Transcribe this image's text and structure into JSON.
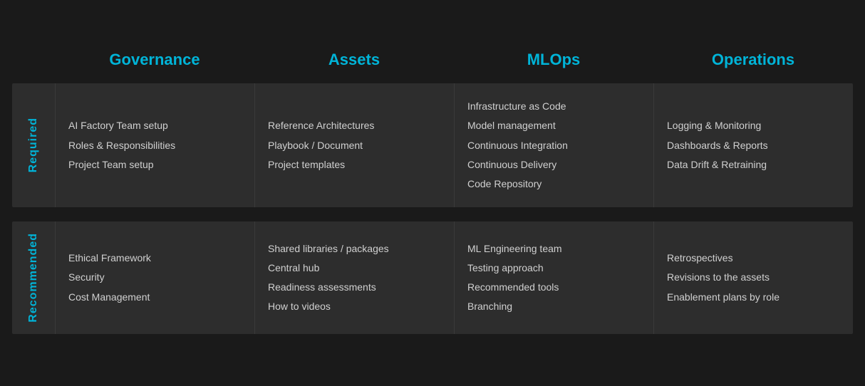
{
  "colors": {
    "accent": "#00b4d8",
    "background": "#1a1a1a",
    "cell_bg": "#2d2d2d",
    "text": "#d0d0d0"
  },
  "headers": {
    "spacer": "",
    "col1": "Governance",
    "col2": "Assets",
    "col3": "MLOps",
    "col4": "Operations"
  },
  "sections": [
    {
      "label": "Required",
      "col1": [
        "AI Factory Team setup",
        "Roles & Responsibilities",
        "Project Team setup"
      ],
      "col2": [
        "Reference Architectures",
        "Playbook / Document",
        "Project templates"
      ],
      "col3": [
        "Infrastructure as Code",
        "Model management",
        "Continuous Integration",
        "Continuous Delivery",
        "Code Repository"
      ],
      "col4": [
        "Logging & Monitoring",
        "Dashboards & Reports",
        "Data Drift & Retraining"
      ]
    },
    {
      "label": "Recommended",
      "col1": [
        "Ethical Framework",
        "Security",
        "Cost Management"
      ],
      "col2": [
        "Shared libraries / packages",
        "Central hub",
        "Readiness assessments",
        "How to videos"
      ],
      "col3": [
        "ML Engineering team",
        "Testing approach",
        "Recommended tools",
        "Branching"
      ],
      "col4": [
        "Retrospectives",
        "Revisions to the assets",
        "Enablement plans by role"
      ]
    }
  ]
}
